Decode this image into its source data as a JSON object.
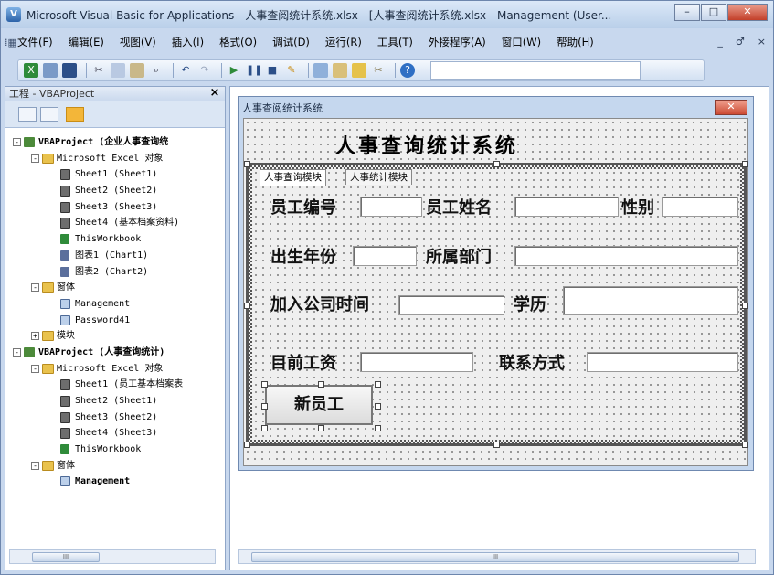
{
  "window": {
    "title": "Microsoft Visual Basic for Applications - 人事查阅统计系统.xlsx - [人事查阅统计系统.xlsx - Management (User...",
    "controls": [
      "–",
      "□",
      "✕"
    ]
  },
  "menubar": {
    "items": [
      "文件(F)",
      "编辑(E)",
      "视图(V)",
      "插入(I)",
      "格式(O)",
      "调试(D)",
      "运行(R)",
      "工具(T)",
      "外接程序(A)",
      "窗口(W)",
      "帮助(H)"
    ],
    "mdi_controls": [
      "_",
      "♂",
      "×"
    ]
  },
  "toolbar": {
    "icons": [
      "excel-icon",
      "insert-userform-icon",
      "save-icon",
      "cut-icon",
      "copy-icon",
      "paste-icon",
      "find-icon",
      "undo-icon",
      "redo-icon",
      "run-icon",
      "break-icon",
      "reset-icon",
      "design-mode-icon",
      "project-explorer-icon",
      "properties-icon",
      "object-browser-icon",
      "toolbox-icon",
      "help-icon"
    ]
  },
  "project_panel": {
    "title": "工程 - VBAProject",
    "close": "×",
    "tree": [
      {
        "indent": 0,
        "icon": "proj",
        "label": "VBAProject (企业人事查询统",
        "bold": true,
        "toggle": "-"
      },
      {
        "indent": 1,
        "icon": "folder",
        "label": "Microsoft Excel 对象",
        "toggle": "-"
      },
      {
        "indent": 2,
        "icon": "sheet",
        "label": "Sheet1 (Sheet1)"
      },
      {
        "indent": 2,
        "icon": "sheet",
        "label": "Sheet2 (Sheet2)"
      },
      {
        "indent": 2,
        "icon": "sheet",
        "label": "Sheet3 (Sheet3)"
      },
      {
        "indent": 2,
        "icon": "sheet",
        "label": "Sheet4 (基本档案资料)"
      },
      {
        "indent": 2,
        "icon": "wb",
        "label": "ThisWorkbook"
      },
      {
        "indent": 2,
        "icon": "chart",
        "label": "图表1 (Chart1)"
      },
      {
        "indent": 2,
        "icon": "chart",
        "label": "图表2 (Chart2)"
      },
      {
        "indent": 1,
        "icon": "folder",
        "label": "窗体",
        "toggle": "-"
      },
      {
        "indent": 2,
        "icon": "form",
        "label": "Management"
      },
      {
        "indent": 2,
        "icon": "form",
        "label": "Password41"
      },
      {
        "indent": 1,
        "icon": "folder",
        "label": "模块",
        "toggle": "+"
      },
      {
        "indent": 0,
        "icon": "proj",
        "label": "VBAProject (人事查询统计)",
        "bold": true,
        "toggle": "-"
      },
      {
        "indent": 1,
        "icon": "folder",
        "label": "Microsoft Excel 对象",
        "toggle": "-"
      },
      {
        "indent": 2,
        "icon": "sheet",
        "label": "Sheet1 (员工基本档案表"
      },
      {
        "indent": 2,
        "icon": "sheet",
        "label": "Sheet2 (Sheet1)"
      },
      {
        "indent": 2,
        "icon": "sheet",
        "label": "Sheet3 (Sheet2)"
      },
      {
        "indent": 2,
        "icon": "sheet",
        "label": "Sheet4 (Sheet3)"
      },
      {
        "indent": 2,
        "icon": "wb",
        "label": "ThisWorkbook"
      },
      {
        "indent": 1,
        "icon": "folder",
        "label": "窗体",
        "toggle": "-"
      },
      {
        "indent": 2,
        "icon": "form",
        "label": "Management",
        "bold": true
      }
    ],
    "scroll_grip": "III"
  },
  "userform": {
    "title": "人事查阅统计系统",
    "close": "✕",
    "heading": "人事查询统计系统",
    "tabs": [
      "人事查询模块",
      "人事统计模块"
    ],
    "labels": {
      "emp_id": "员工编号",
      "emp_name": "员工姓名",
      "gender": "性别",
      "birth_year": "出生年份",
      "dept": "所属部门",
      "join_date": "加入公司时间",
      "education": "学历",
      "salary": "目前工资",
      "contact": "联系方式"
    },
    "new_button": "新员工"
  },
  "main_scroll_grip": "III"
}
